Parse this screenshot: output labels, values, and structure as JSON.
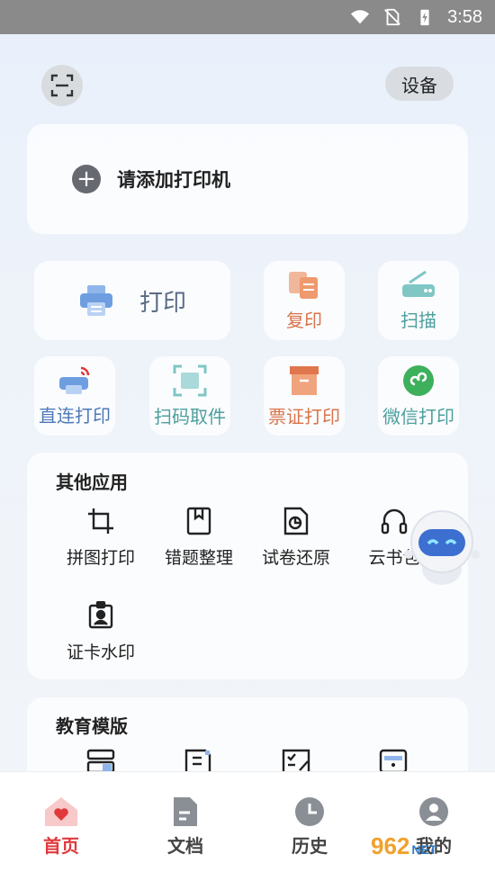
{
  "status_bar": {
    "time": "3:58"
  },
  "header": {
    "device_label": "设备"
  },
  "add_printer": {
    "label": "请添加打印机"
  },
  "main_actions": {
    "print": "打印",
    "copy": "复印",
    "scan": "扫描",
    "direct_print": "直连打印",
    "qr_pickup": "扫码取件",
    "ticket_print": "票证打印",
    "wechat_print": "微信打印"
  },
  "other_apps": {
    "title": "其他应用",
    "items": [
      "拼图打印",
      "错题整理",
      "试卷还原",
      "云书包",
      "证卡水印"
    ]
  },
  "education": {
    "title": "教育模版"
  },
  "bottom_nav": {
    "home": "首页",
    "documents": "文档",
    "history": "历史",
    "mine": "我的"
  },
  "watermark": {
    "brand": "962",
    "suffix": "NET"
  },
  "colors": {
    "accent": "#e0393c",
    "print_blue": "#6e9ee0",
    "copy_orange": "#ee9a6e",
    "scan_teal": "#7fc6c5",
    "wechat_green": "#3db05c"
  }
}
